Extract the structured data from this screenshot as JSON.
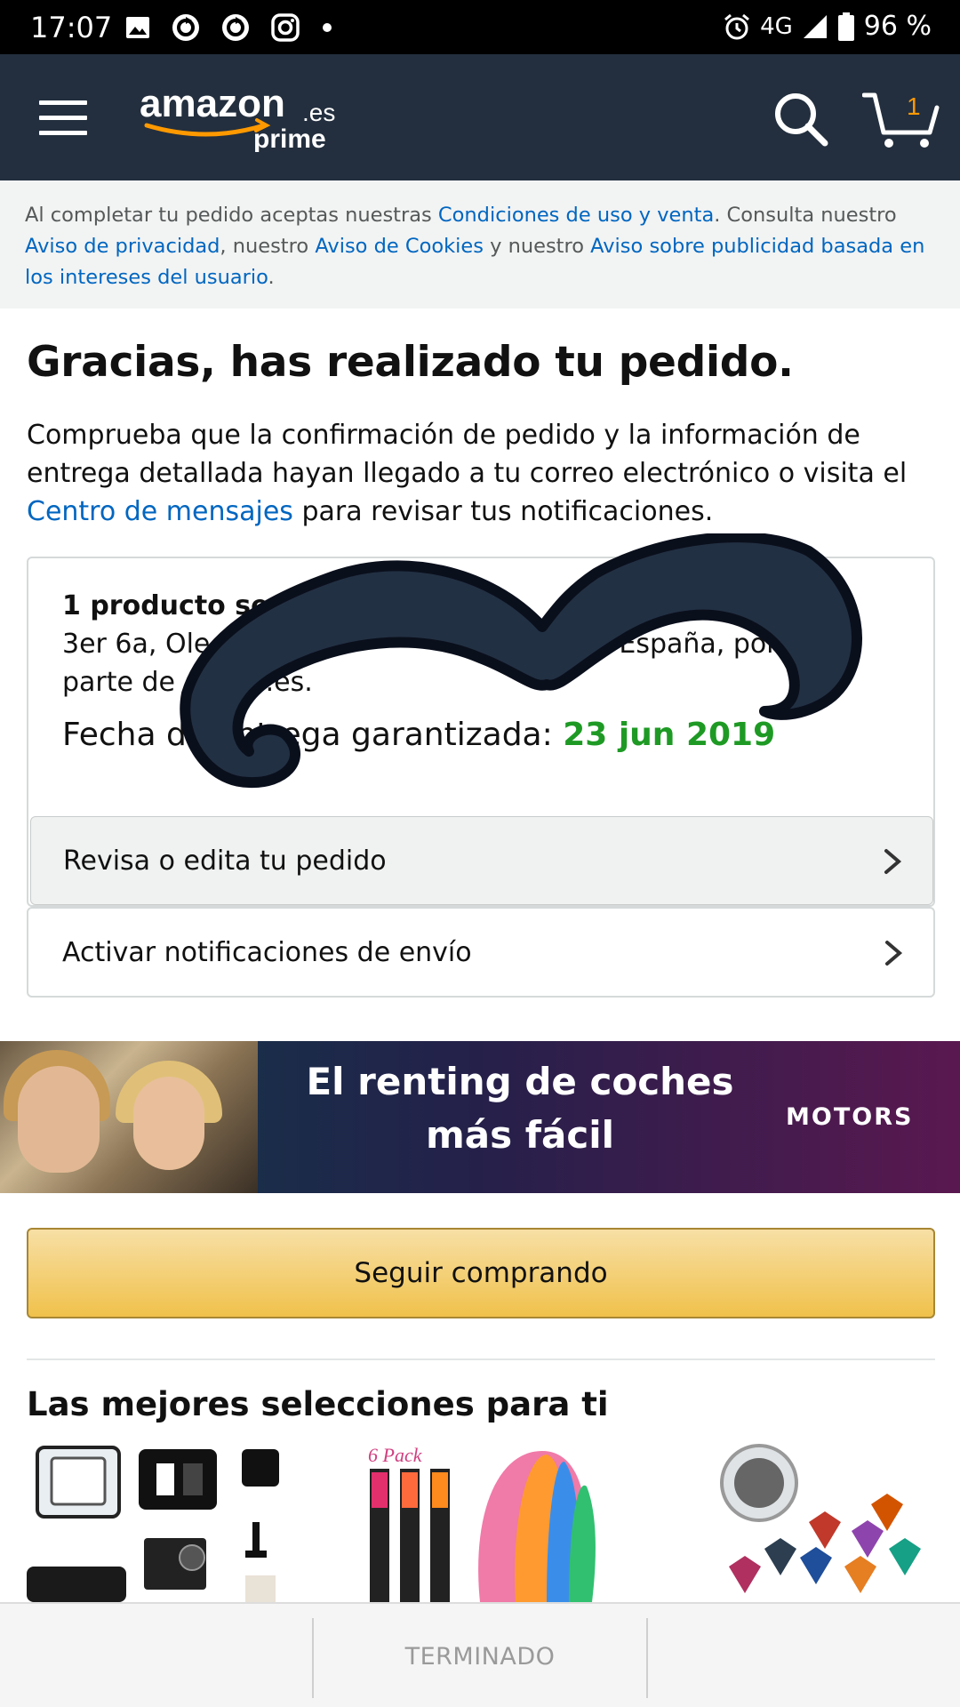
{
  "status_bar": {
    "time": "17:07",
    "network": "4G",
    "battery": "96 %",
    "icons": [
      "image-icon",
      "sync-icon",
      "sync-icon",
      "instagram-icon",
      "dot-icon",
      "alarm-icon",
      "signal-icon",
      "battery-icon"
    ]
  },
  "header": {
    "logo_text": "amazon",
    "logo_domain": ".es",
    "logo_sub": "prime",
    "cart_count": "1",
    "brand_color": "#232f3e",
    "accent_color": "#ff9900"
  },
  "legal": {
    "prefix": "Al completar tu pedido aceptas nuestras ",
    "link1": "Condiciones de uso y venta",
    "mid1": ". Consulta nuestro ",
    "link2": "Aviso de privacidad",
    "mid2": ", nuestro ",
    "link3": "Aviso de Cookies",
    "mid3": " y nuestro ",
    "link4": "Aviso sobre publicidad basada en los intereses del usuario",
    "suffix": "."
  },
  "main": {
    "title": "Gracias, has realizado tu pedido.",
    "intro_text": "Comprueba que la confirmación de pedido y la información de entrega detallada hayan llegado a tu correo electrónico o visita el ",
    "intro_link": "Centro de mensajes",
    "intro_suffix": " para revisar tus notificaciones."
  },
  "order_card": {
    "ship_bold": "1 producto se",
    "ship_line2": "3er 6a, Ole",
    "ship_line2_end": "España, por",
    "ship_line3_a": "parte de A",
    "ship_line3_b": "azon.es.",
    "delivery_label": "Fecha de entrega garantizada: ",
    "delivery_date": "23 jun 2019",
    "review_label": "Revisa o edita tu pedido"
  },
  "notify_label": "Activar notificaciones de envío",
  "banner": {
    "line1": "El renting de coches",
    "line2": "más fácil",
    "brand": "MOTORS"
  },
  "continue_label": "Seguir comprando",
  "recommendations": {
    "title": "Las mejores selecciones para ti",
    "badge": "6 Pack"
  },
  "bottom_bar": {
    "done_label": "TERMINADO"
  }
}
